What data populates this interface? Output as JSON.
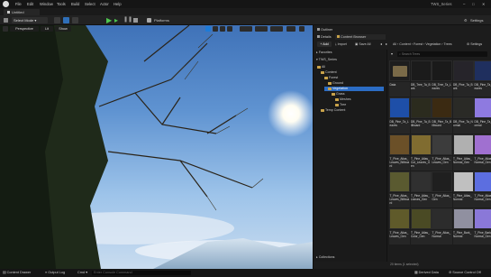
{
  "menubar": {
    "items": [
      "File",
      "Edit",
      "Window",
      "Tools",
      "Build",
      "Select",
      "Actor",
      "Help"
    ],
    "project": "TWS_Series",
    "window_controls": [
      "–",
      "□",
      "✕"
    ]
  },
  "tabbar": {
    "level_tab": "Untitled"
  },
  "toolbar": {
    "select_mode": "Select Mode",
    "platforms": "Platforms",
    "settings": "Settings"
  },
  "viewport": {
    "perspective": "Perspective",
    "lit": "Lit",
    "show": "Show"
  },
  "outliner": {
    "title": "Outliner"
  },
  "details": {
    "title": "Details"
  },
  "content_browser": {
    "title": "Content Browser",
    "add": "+ Add",
    "import": "Import",
    "save_all": "Save All",
    "breadcrumb": [
      "All",
      "Content",
      "Forest",
      "Vegetation",
      "Trees"
    ],
    "settings": "Settings",
    "favorites": "Favorites",
    "project": "TWS_Series",
    "search_placeholder": "Search Trees",
    "tree": [
      {
        "label": "All",
        "depth": 0
      },
      {
        "label": "Content",
        "depth": 1
      },
      {
        "label": "Forest",
        "depth": 2
      },
      {
        "label": "Ground",
        "depth": 3
      },
      {
        "label": "Vegetation",
        "depth": 3,
        "selected": true
      },
      {
        "label": "Grass",
        "depth": 4
      },
      {
        "label": "Meshes",
        "depth": 5
      },
      {
        "label": "Tree",
        "depth": 5
      },
      {
        "label": "Temp Content",
        "depth": 1
      }
    ],
    "assets": [
      {
        "label": "Data",
        "color": "#7a6a48"
      },
      {
        "label": "DB_Tree_Ta_Bark",
        "color": "#1b1b1b"
      },
      {
        "label": "DB_Tree_Ta_Leaves",
        "color": "#1a1a1a"
      },
      {
        "label": "DB_Pine_Ta_Bark",
        "color": "#26242a"
      },
      {
        "label": "DB_Pine_Ta_Leaves",
        "color": "#1f2f5e"
      },
      {
        "label": "DB_Pine_Ta_Leaves",
        "color": "#1e4fa8"
      },
      {
        "label": "DB_Pine_Ta_Billboard",
        "color": "#2b2b1e"
      },
      {
        "label": "DB_Pine_Ta_Billboard",
        "color": "#3b2a12"
      },
      {
        "label": "DB_Pine_Ta_Normal",
        "color": "#2a2a26"
      },
      {
        "label": "DB_Pine_Ta_Normal",
        "color": "#8e7ae0"
      },
      {
        "label": "T_Pine_Atlas_Leaves_Billboard",
        "color": "#6b5028"
      },
      {
        "label": "T_Pine_Atlas_Cut_Leaves_Gen",
        "color": "#806c30"
      },
      {
        "label": "T_Pine_Atlas_Leaves_Gen",
        "color": "#3c3c3c"
      },
      {
        "label": "T_Pine_Atlas_Normal_Gen",
        "color": "#b0b0b0"
      },
      {
        "label": "T_Pine_Atlas_Normal_Gen",
        "color": "#a070d0"
      },
      {
        "label": "T_Pine_Atlas_Leaves_Billboard",
        "color": "#5a5a30"
      },
      {
        "label": "T_Pine_Atlas_Leaves_Gen",
        "color": "#303030"
      },
      {
        "label": "T_Pine_Atlas_Gen",
        "color": "#1f1f1f"
      },
      {
        "label": "T_Pine_Atlas_Normal",
        "color": "#c0c0c0"
      },
      {
        "label": "T_Pine_Atlas_Normal_Gen",
        "color": "#5c6ee0"
      },
      {
        "label": "T_Pine_Atlas_Leaves_Gen",
        "color": "#5f5a2a"
      },
      {
        "label": "T_Pine_Atlas_Color_Gen",
        "color": "#4a4a24"
      },
      {
        "label": "T_Pine_Atlas_Normal",
        "color": "#2c2c2c"
      },
      {
        "label": "T_Pine_Bark_Normal",
        "color": "#9090a0"
      },
      {
        "label": "T_Pine_Bark_Normal_Gen",
        "color": "#8a78d8"
      }
    ],
    "collections": "Collections",
    "item_count": "20 items (1 selected)"
  },
  "statusbar": {
    "content_drawer": "Content Drawer",
    "output_log": "Output Log",
    "cmd": "Cmd",
    "cmd_placeholder": "Enter Console Command",
    "derived_data": "Derived Data",
    "source_control": "Source Control Off"
  },
  "colors": {
    "accent": "#1d7bd8",
    "selected": "#2b6cc4"
  }
}
